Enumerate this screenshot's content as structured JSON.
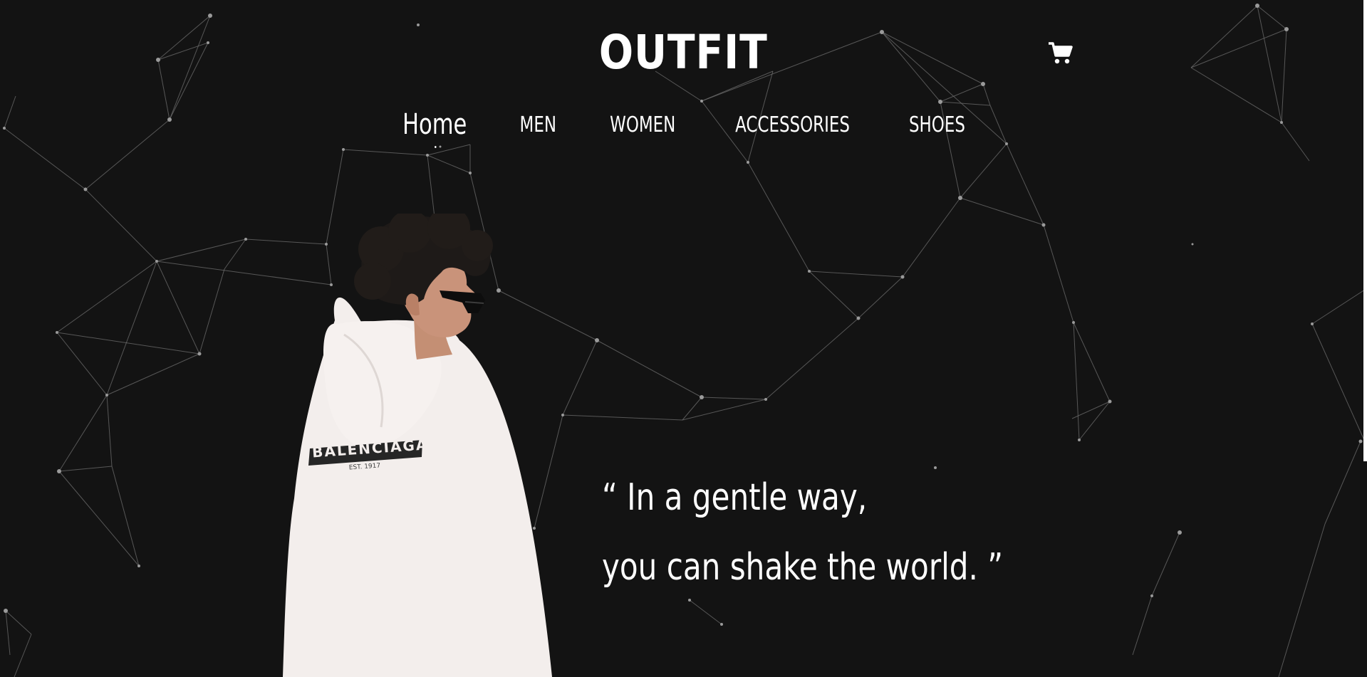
{
  "brand": {
    "logo": "OUTFIT"
  },
  "header": {
    "cart_icon": "shopping-cart-icon"
  },
  "nav": {
    "items": [
      {
        "label": "Home",
        "active": true
      },
      {
        "label": "MEN",
        "active": false
      },
      {
        "label": "WOMEN",
        "active": false
      },
      {
        "label": "ACCESSORIES",
        "active": false
      },
      {
        "label": "SHOES",
        "active": false
      }
    ]
  },
  "hero": {
    "quote_line_1": "“ In a gentle way,",
    "quote_line_2": "you can shake the world. ”",
    "hoodie_print": "BALENCIAGA",
    "hoodie_subprint": "EST. 1917"
  },
  "colors": {
    "background": "#131313",
    "text": "#ffffff",
    "hoodie": "#f3eeec"
  }
}
